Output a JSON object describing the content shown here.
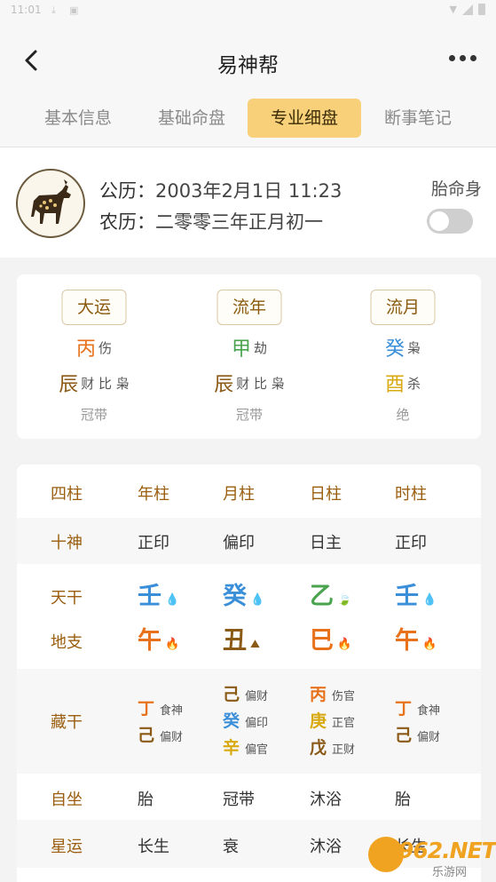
{
  "status_bar": {
    "time": "11:01"
  },
  "header": {
    "title": "易神帮"
  },
  "tabs": [
    {
      "label": "基本信息",
      "active": false
    },
    {
      "label": "基础命盘",
      "active": false
    },
    {
      "label": "专业细盘",
      "active": true
    },
    {
      "label": "断事笔记",
      "active": false
    }
  ],
  "profile": {
    "solar_label": "公历：",
    "solar_date": "2003年2月1日 11:23",
    "lunar_label": "农历：",
    "lunar_date": "二零零三年正月初一",
    "toggle_label": "胎命身",
    "toggle_on": false,
    "avatar_icon": "goat-icon"
  },
  "luck": [
    {
      "button": "大运",
      "stem": "丙",
      "stem_element": "fire",
      "stem_god": "伤",
      "branch": "辰",
      "branch_element": "earth",
      "branch_gods": "财 比 枭",
      "stage": "冠带"
    },
    {
      "button": "流年",
      "stem": "甲",
      "stem_element": "wood",
      "stem_god": "劫",
      "branch": "辰",
      "branch_element": "earth",
      "branch_gods": "财 比 枭",
      "stage": "冠带"
    },
    {
      "button": "流月",
      "stem": "癸",
      "stem_element": "water",
      "stem_god": "枭",
      "branch": "酉",
      "branch_element": "metal",
      "branch_gods": "杀",
      "stage": "绝"
    }
  ],
  "pillars": {
    "header": [
      "四柱",
      "年柱",
      "月柱",
      "日柱",
      "时柱"
    ],
    "ten_gods": {
      "label": "十神",
      "values": [
        "正印",
        "偏印",
        "日主",
        "正印"
      ]
    },
    "stems": {
      "label": "天干",
      "values": [
        {
          "char": "壬",
          "element": "water",
          "icon": "water-drop-icon"
        },
        {
          "char": "癸",
          "element": "water",
          "icon": "water-drop-icon"
        },
        {
          "char": "乙",
          "element": "wood",
          "icon": "leaf-icon"
        },
        {
          "char": "壬",
          "element": "water",
          "icon": "water-drop-icon"
        }
      ]
    },
    "branches": {
      "label": "地支",
      "values": [
        {
          "char": "午",
          "element": "fire",
          "icon": "flame-icon"
        },
        {
          "char": "丑",
          "element": "earth",
          "icon": "mountain-icon"
        },
        {
          "char": "巳",
          "element": "fire",
          "icon": "flame-icon"
        },
        {
          "char": "午",
          "element": "fire",
          "icon": "flame-icon"
        }
      ]
    },
    "hidden": {
      "label": "藏干",
      "values": [
        [
          {
            "char": "丁",
            "element": "fire",
            "god": "食神"
          },
          {
            "char": "己",
            "element": "earth",
            "god": "偏财"
          }
        ],
        [
          {
            "char": "己",
            "element": "earth",
            "god": "偏财"
          },
          {
            "char": "癸",
            "element": "water",
            "god": "偏印"
          },
          {
            "char": "辛",
            "element": "metal",
            "god": "偏官"
          }
        ],
        [
          {
            "char": "丙",
            "element": "fire",
            "god": "伤官"
          },
          {
            "char": "庚",
            "element": "metal",
            "god": "正官"
          },
          {
            "char": "戊",
            "element": "earth",
            "god": "正财"
          }
        ],
        [
          {
            "char": "丁",
            "element": "fire",
            "god": "食神"
          },
          {
            "char": "己",
            "element": "earth",
            "god": "偏财"
          }
        ]
      ]
    },
    "self_seat": {
      "label": "自坐",
      "values": [
        "胎",
        "冠带",
        "沐浴",
        "胎"
      ]
    },
    "star_luck": {
      "label": "星运",
      "values": [
        "长生",
        "衰",
        "沐浴",
        "长生"
      ]
    }
  },
  "watermark": {
    "brand": "962.NET",
    "sub": "乐游网"
  },
  "colors": {
    "accent_tab": "#f8d07a",
    "water": "#3b8fd9",
    "fire": "#e8721c",
    "earth": "#8a5a16",
    "wood": "#4aa44f",
    "metal": "#d8a90e",
    "header_text": "#9a5e0e"
  }
}
